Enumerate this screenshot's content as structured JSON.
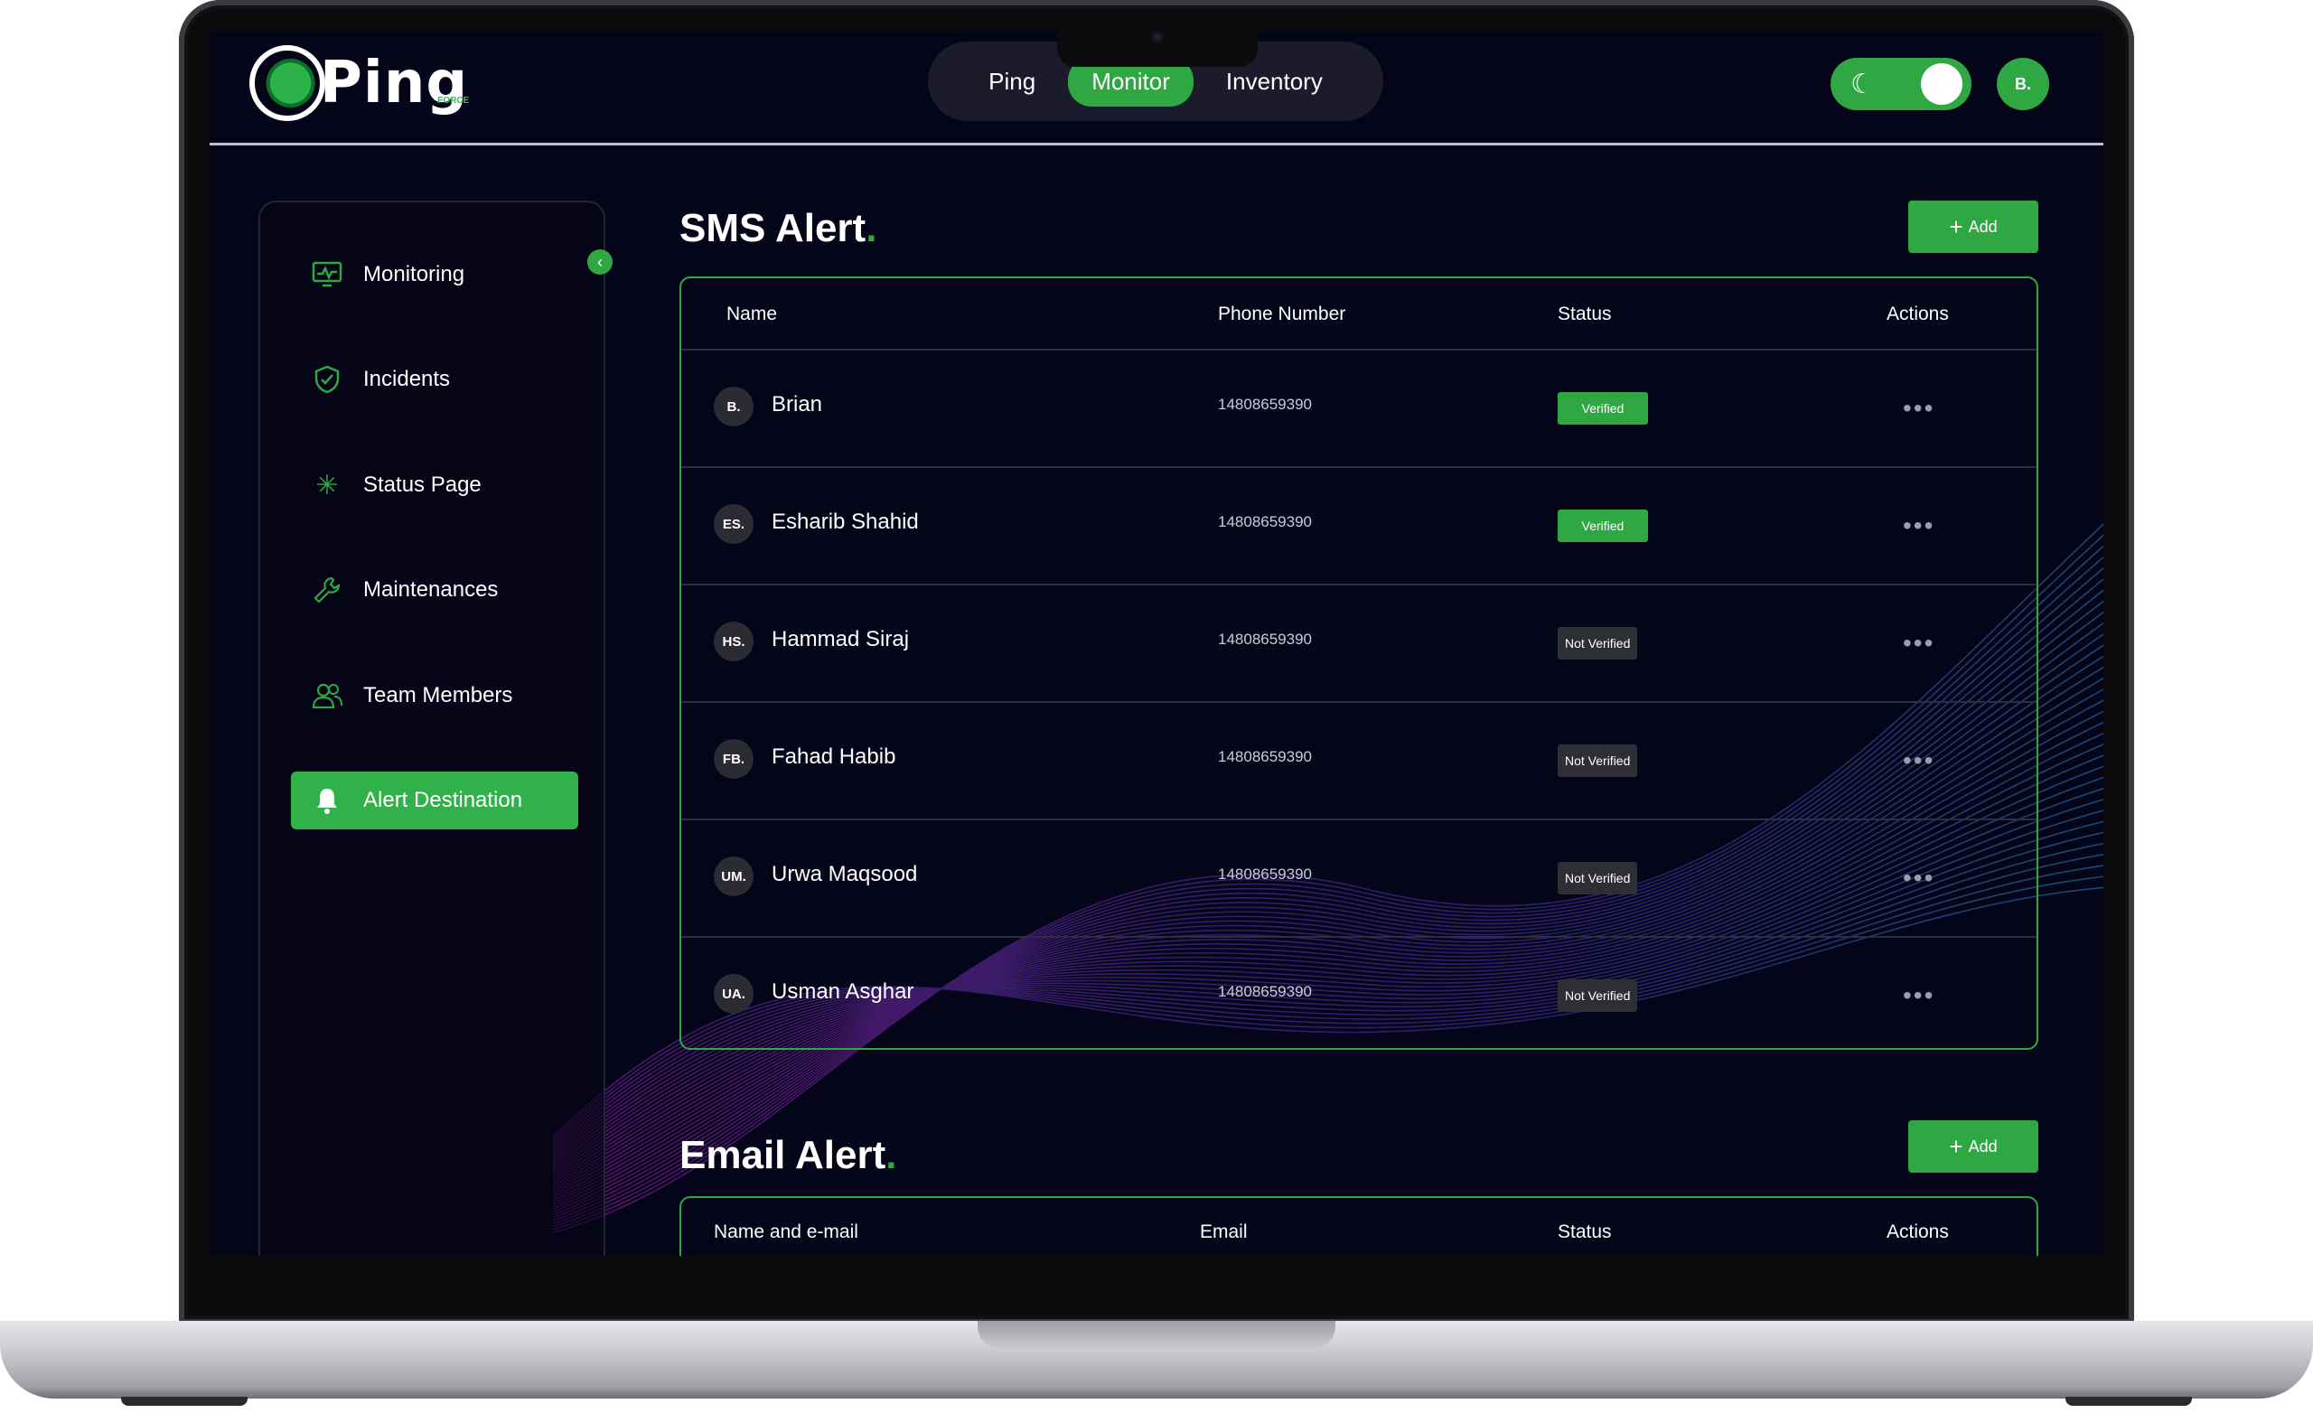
{
  "nav": {
    "logo_text": "Ping",
    "logo_sub": "FORCE",
    "tabs": [
      {
        "label": "Ping",
        "active": false
      },
      {
        "label": "Monitor",
        "active": true
      },
      {
        "label": "Inventory",
        "active": false
      }
    ],
    "avatar": "B."
  },
  "sidebar": {
    "items": [
      {
        "label": "Monitoring",
        "icon": "monitor-icon",
        "active": false
      },
      {
        "label": "Incidents",
        "icon": "shield-check-icon",
        "active": false
      },
      {
        "label": "Status Page",
        "icon": "sparkle-icon",
        "active": false
      },
      {
        "label": "Maintenances",
        "icon": "wrench-icon",
        "active": false
      },
      {
        "label": "Team Members",
        "icon": "users-icon",
        "active": false
      },
      {
        "label": "Alert Destination",
        "icon": "bell-icon",
        "active": true
      }
    ]
  },
  "sms": {
    "title": "SMS Alert",
    "add_label": "Add",
    "columns": [
      "Name",
      "Phone Number",
      "Status",
      "Actions"
    ],
    "rows": [
      {
        "initials": "B.",
        "name": "Brian",
        "phone": "14808659390",
        "status": "Verified"
      },
      {
        "initials": "ES.",
        "name": "Esharib Shahid",
        "phone": "14808659390",
        "status": "Verified"
      },
      {
        "initials": "HS.",
        "name": "Hammad Siraj",
        "phone": "14808659390",
        "status": "Not Verified"
      },
      {
        "initials": "FB.",
        "name": "Fahad Habib",
        "phone": "14808659390",
        "status": "Not Verified"
      },
      {
        "initials": "UM.",
        "name": "Urwa Maqsood",
        "phone": "14808659390",
        "status": "Not Verified"
      },
      {
        "initials": "UA.",
        "name": "Usman Asghar",
        "phone": "14808659390",
        "status": "Not Verified"
      }
    ]
  },
  "email": {
    "title": "Email Alert",
    "add_label": "Add",
    "columns": [
      "Name and e-mail",
      "Email",
      "Status",
      "Actions"
    ]
  },
  "colors": {
    "accent": "#2fa843",
    "background": "#05051a"
  }
}
